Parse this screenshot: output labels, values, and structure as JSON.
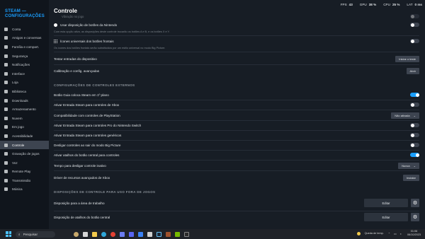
{
  "sidebar": {
    "title_line1": "STEAM —",
    "title_line2": "CONFIGURAÇÕES",
    "items": [
      {
        "label": "Conta",
        "icon": "user-icon"
      },
      {
        "label": "Amigos e conversas",
        "icon": "friends-icon"
      },
      {
        "label": "Família e compart.",
        "icon": "family-icon"
      },
      {
        "label": "Segurança",
        "icon": "shield-icon"
      },
      {
        "label": "Notificações",
        "icon": "bell-icon"
      },
      {
        "label": "Interface",
        "icon": "monitor-icon"
      },
      {
        "label": "Loja",
        "icon": "store-icon"
      },
      {
        "label": "Biblioteca",
        "icon": "library-icon"
      },
      {
        "label": "Downloads",
        "icon": "download-icon"
      },
      {
        "label": "Armazenamento",
        "icon": "storage-icon"
      },
      {
        "label": "Nuvem",
        "icon": "cloud-icon"
      },
      {
        "label": "Em jogo",
        "icon": "ingame-icon"
      },
      {
        "label": "Acessibilidade",
        "icon": "accessibility-icon"
      },
      {
        "label": "Controle",
        "icon": "controller-icon",
        "active": true
      },
      {
        "label": "Gravação de jogos",
        "icon": "record-icon"
      },
      {
        "label": "Voz",
        "icon": "microphone-icon"
      },
      {
        "label": "Remote Play",
        "icon": "remote-play-icon"
      },
      {
        "label": "Transmissão",
        "icon": "broadcast-icon"
      },
      {
        "label": "Música",
        "icon": "music-icon"
      }
    ]
  },
  "topbar": {
    "fps_label": "FPS",
    "fps_value": "43",
    "gpu_label": "GPU",
    "gpu_value": "38 %",
    "cpu_label": "CPU",
    "cpu_value": "25 %",
    "lat_label": "LAT",
    "lat_value": "0 ms"
  },
  "main": {
    "title": "Controle",
    "faded_item": "Vibração no jogo",
    "nintendo_layout": {
      "label": "Usar disposição de botões da Nintendo",
      "desc": "Com esta opção ativa, as disposições deste controle trocarão os botões A e B, e os botões X e Y.",
      "on": false
    },
    "universal_icons": {
      "label": "Ícones universais dos botões frontais",
      "desc": "Os ícones dos botões frontais serão substituídos por um estilo universal no modo Big Picture.",
      "on": false
    },
    "test_inputs": {
      "label": "Testar entradas do dispositivo",
      "button": "Iniciar o teste"
    },
    "calibration": {
      "label": "Calibração e config. avançadas",
      "button": "Abrir"
    },
    "external_section": "CONFIGURAÇÕES DE CONTROLES EXTERNOS",
    "guide_focus": {
      "label": "Botão Guia coloca Steam em 1º plano",
      "on": true
    },
    "xbox_input": {
      "label": "Ativar Entrada Steam para controles de Xbox",
      "on": false
    },
    "playstation": {
      "label": "Compatibilidade com controles de PlayStation",
      "value": "Não ativada"
    },
    "switch_pro": {
      "label": "Ativar Entrada Steam para controles Pro do Nintendo Switch",
      "on": false
    },
    "generic": {
      "label": "Ativar Entrada Steam para controles genéricos",
      "on": false
    },
    "disconnect": {
      "label": "Desligar controles ao sair do modo Big Picture",
      "on": false
    },
    "guide_shortcuts": {
      "label": "Ativar atalhos do botão central para controles",
      "on": true
    },
    "idle_timeout": {
      "label": "Tempo para desligar controle inativo",
      "value": "Nunca"
    },
    "xbox_driver": {
      "label": "Driver de recursos avançados de Xbox",
      "button": "Instalar"
    },
    "non_game_section": "DISPOSIÇÕES DE CONTROLE PARA USO FORA DE JOGOS",
    "desktop_layout": {
      "label": "Disposição para a área de trabalho",
      "button": "Editar"
    },
    "guide_layout": {
      "label": "Disposição de atalhos do botão central",
      "button": "Editar"
    }
  },
  "taskbar": {
    "search_placeholder": "Pesquisar",
    "weather": "Queda de temp.",
    "time": "01:06",
    "date": "06/10/2023"
  },
  "colors": {
    "accent": "#1a9fff",
    "background": "#171d25",
    "sidebar": "#10151c"
  }
}
